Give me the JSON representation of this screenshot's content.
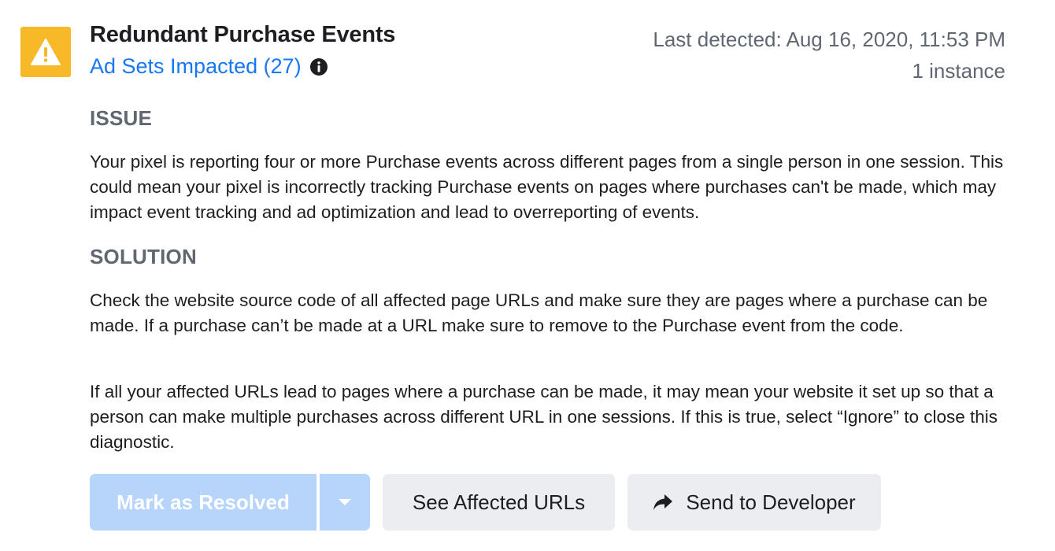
{
  "header": {
    "title": "Redundant Purchase Events",
    "ad_sets_link": "Ad Sets Impacted (27)",
    "last_detected": "Last detected: Aug 16, 2020, 11:53 PM",
    "instances": "1 instance"
  },
  "issue": {
    "label": "ISSUE",
    "text": "Your pixel is reporting four or more Purchase events across different pages from a single person in one session. This could mean your pixel is incorrectly tracking Purchase events on pages where purchases can't be made, which may impact event tracking and ad optimization and lead to overreporting of events."
  },
  "solution": {
    "label": "SOLUTION",
    "text_1": "Check the website source code of all affected page URLs and make sure they are pages where a purchase can be made. If a purchase can’t be made at a URL make sure to remove to the Purchase event from the code.",
    "text_2": "If all your affected URLs lead to pages where a purchase can be made, it may mean your website it set up so that a person can make multiple purchases across different URL in one sessions. If this is true, select “Ignore” to close this diagnostic."
  },
  "actions": {
    "mark_resolved": "Mark as Resolved",
    "see_affected": "See Affected URLs",
    "send_developer": "Send to Developer"
  },
  "icons": {
    "warning": "warning-icon",
    "info": "info-icon",
    "dropdown": "chevron-down-icon",
    "share": "share-arrow-icon"
  },
  "colors": {
    "warning_bg": "#f7b928",
    "link": "#1877f2",
    "primary_disabled": "#b7d4fb",
    "secondary_button": "#ebedf0",
    "muted_text": "#606770"
  }
}
